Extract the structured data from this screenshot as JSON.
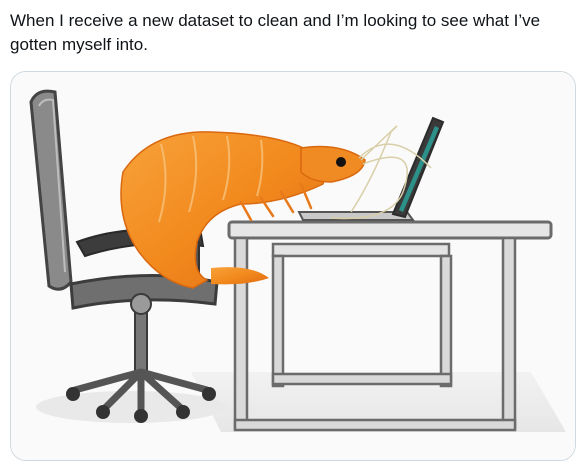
{
  "tweet": {
    "text": "When I receive a new dataset to clean and I’m looking to see what I’ve gotten myself into."
  },
  "media": {
    "icons": [
      "office-chair",
      "shrimp",
      "desk",
      "laptop"
    ],
    "colors": {
      "shrimp": "#f28a1e",
      "chair": "#6f6f6f",
      "desk": "#8a8a8a",
      "laptop_screen": "#2aa198"
    }
  }
}
